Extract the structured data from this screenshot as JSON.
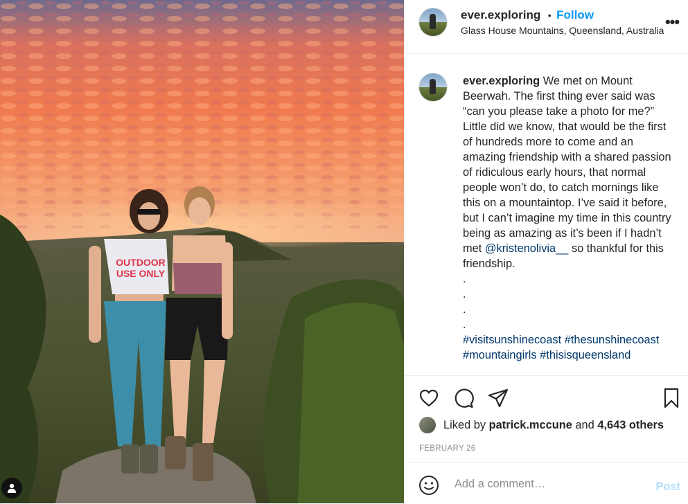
{
  "post": {
    "username": "ever.exploring",
    "follow_label": "Follow",
    "location": "Glass House Mountains, Queensland, Australia",
    "separator": "•",
    "more_label": "•••"
  },
  "caption": {
    "username": "ever.exploring",
    "text_before_mention": " We met on Mount Beerwah. The first thing ever said was “can you please take a photo for me?” Little did we know, that would be the first of hundreds more to come and an amazing friendship with a shared passion of ridiculous early hours, that normal people won’t do, to catch mornings like this on a mountaintop. I’ve said it before, but I can’t imagine my time in this country being as amazing as it’s been if I hadn’t met ",
    "mention": "@kristenolivia__",
    "text_after_mention": " so thankful for this friendship.",
    "dots": [
      ".",
      ".",
      ".",
      "."
    ],
    "hashtags": [
      "#visitsunshinecoast",
      "#thesunshinecoast",
      "#mountaingirls",
      "#thisisqueensland"
    ]
  },
  "photo": {
    "shirt_text_line1": "OUTDOOR",
    "shirt_text_line2": "USE ONLY"
  },
  "likes": {
    "prefix": "Liked by ",
    "user": "patrick.mccune",
    "middle": " and ",
    "count": "4,643 others"
  },
  "date": "FEBRUARY 26",
  "comment": {
    "placeholder": "Add a comment…",
    "post_label": "Post"
  },
  "icons": {
    "like": "heart-icon",
    "comment": "comment-icon",
    "share": "share-icon",
    "save": "bookmark-icon",
    "emoji": "emoji-icon",
    "more": "more-options-icon"
  },
  "colors": {
    "accent": "#0095f6",
    "link": "#00376b",
    "muted": "#8e8e8e",
    "post_disabled": "#b2dffc"
  }
}
